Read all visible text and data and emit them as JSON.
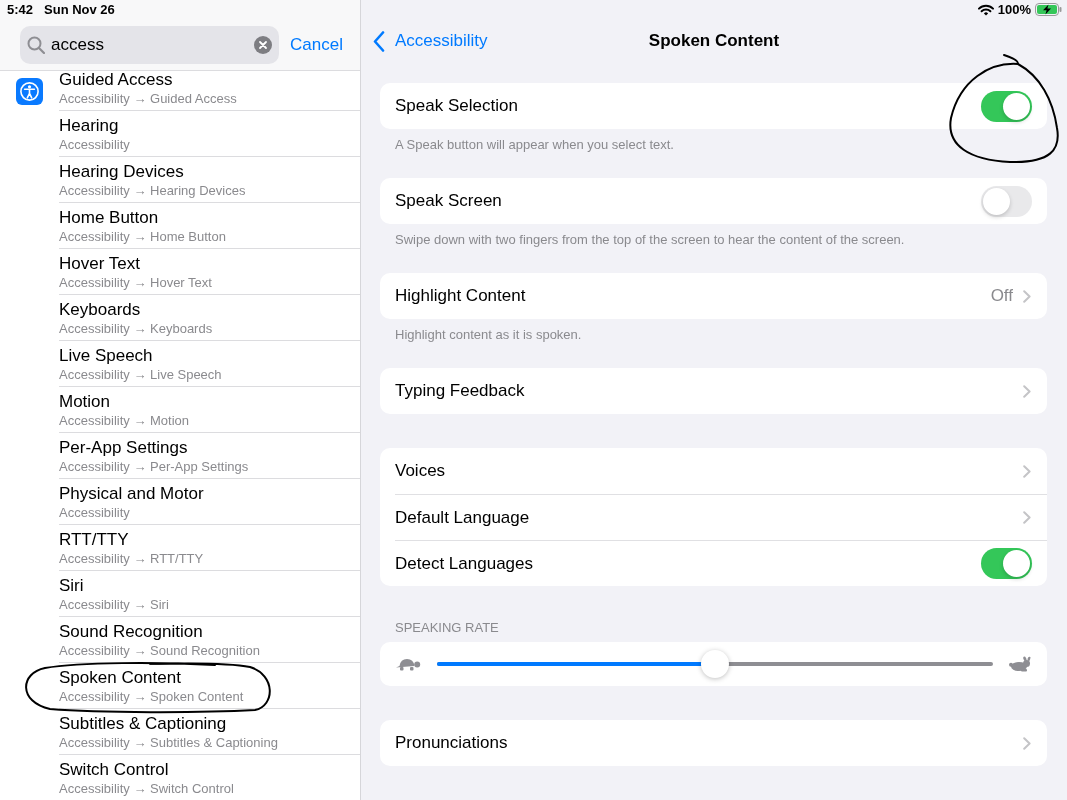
{
  "status_bar": {
    "time": "5:42",
    "date": "Sun Nov 26",
    "battery": "100%",
    "charging": true
  },
  "sidebar": {
    "search": {
      "value": "access"
    },
    "cancel": "Cancel",
    "results": [
      {
        "title": "Guided Access",
        "path": "Accessibility → Guided Access"
      },
      {
        "title": "Hearing",
        "path": "Accessibility"
      },
      {
        "title": "Hearing Devices",
        "path": "Accessibility → Hearing Devices"
      },
      {
        "title": "Home Button",
        "path": "Accessibility → Home Button"
      },
      {
        "title": "Hover Text",
        "path": "Accessibility → Hover Text"
      },
      {
        "title": "Keyboards",
        "path": "Accessibility → Keyboards"
      },
      {
        "title": "Live Speech",
        "path": "Accessibility → Live Speech"
      },
      {
        "title": "Motion",
        "path": "Accessibility → Motion"
      },
      {
        "title": "Per-App Settings",
        "path": "Accessibility → Per-App Settings"
      },
      {
        "title": "Physical and Motor",
        "path": "Accessibility"
      },
      {
        "title": "RTT/TTY",
        "path": "Accessibility → RTT/TTY"
      },
      {
        "title": "Siri",
        "path": "Accessibility → Siri"
      },
      {
        "title": "Sound Recognition",
        "path": "Accessibility → Sound Recognition"
      },
      {
        "title": "Spoken Content",
        "path": "Accessibility → Spoken Content"
      },
      {
        "title": "Subtitles & Captioning",
        "path": "Accessibility → Subtitles & Captioning"
      },
      {
        "title": "Switch Control",
        "path": "Accessibility → Switch Control"
      }
    ]
  },
  "nav": {
    "back": "Accessibility",
    "title": "Spoken Content"
  },
  "groups": [
    {
      "rows": [
        {
          "kind": "toggle",
          "label": "Speak Selection",
          "on": true
        }
      ],
      "footer": "A Speak button will appear when you select text."
    },
    {
      "rows": [
        {
          "kind": "toggle",
          "label": "Speak Screen",
          "on": false
        }
      ],
      "footer": "Swipe down with two fingers from the top of the screen to hear the content of the screen."
    },
    {
      "rows": [
        {
          "kind": "link",
          "label": "Highlight Content",
          "value": "Off"
        }
      ],
      "footer": "Highlight content as it is spoken."
    },
    {
      "rows": [
        {
          "kind": "link",
          "label": "Typing Feedback"
        }
      ]
    },
    {
      "rows": [
        {
          "kind": "link",
          "label": "Voices"
        },
        {
          "kind": "link",
          "label": "Default Language"
        },
        {
          "kind": "toggle",
          "label": "Detect Languages",
          "on": true
        }
      ]
    },
    {
      "header": "SPEAKING RATE",
      "rows": [
        {
          "kind": "slider",
          "level": 0.5
        }
      ]
    },
    {
      "rows": [
        {
          "kind": "link",
          "label": "Pronunciations"
        }
      ]
    }
  ]
}
